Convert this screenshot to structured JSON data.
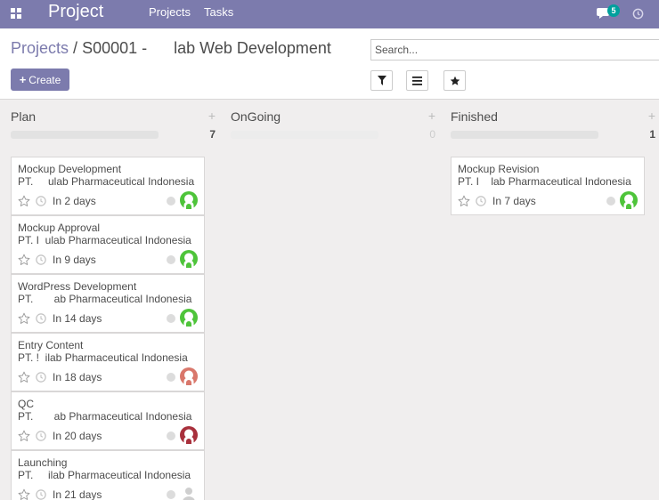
{
  "navbar": {
    "brand": "Project",
    "menu": [
      "Projects",
      "Tasks"
    ],
    "chat_count": "5",
    "colors": {
      "background": "#7c7bad",
      "badge": "#00a09d"
    }
  },
  "control_panel": {
    "breadcrumb_link": "Projects",
    "breadcrumb_sep": "/",
    "breadcrumb_current": "S00001 -      lab Web Development",
    "create_label": "Create",
    "search_placeholder": "Search..."
  },
  "columns": [
    {
      "title": "Plan",
      "count": "7",
      "cards": [
        {
          "title": "Mockup Development",
          "partner": "PT.     ulab Pharmaceutical Indonesia",
          "deadline": "In 2 days",
          "avatar_color": "#4ec43a"
        },
        {
          "title": "Mockup Approval",
          "partner": "PT. I  ulab Pharmaceutical Indonesia",
          "deadline": "In 9 days",
          "avatar_color": "#4ec43a"
        },
        {
          "title": "WordPress Development",
          "partner": "PT.       ab Pharmaceutical Indonesia",
          "deadline": "In 14 days",
          "avatar_color": "#4ec43a"
        },
        {
          "title": "Entry Content",
          "partner": "PT. !  ilab Pharmaceutical Indonesia",
          "deadline": "In 18 days",
          "avatar_color": "#d9776b"
        },
        {
          "title": "QC",
          "partner": "PT.       ab Pharmaceutical Indonesia",
          "deadline": "In 20 days",
          "avatar_color": "#a8303c"
        },
        {
          "title": "Launching",
          "partner": "PT.     ilab Pharmaceutical Indonesia",
          "deadline": "In 21 days",
          "avatar_color": "#cfcfcf"
        }
      ]
    },
    {
      "title": "OnGoing",
      "count": "0",
      "cards": []
    },
    {
      "title": "Finished",
      "count": "1",
      "cards": [
        {
          "title": "Mockup Revision",
          "partner": "PT. I    lab Pharmaceutical Indonesia",
          "deadline": "In 7 days",
          "avatar_color": "#4ec43a"
        }
      ]
    }
  ]
}
